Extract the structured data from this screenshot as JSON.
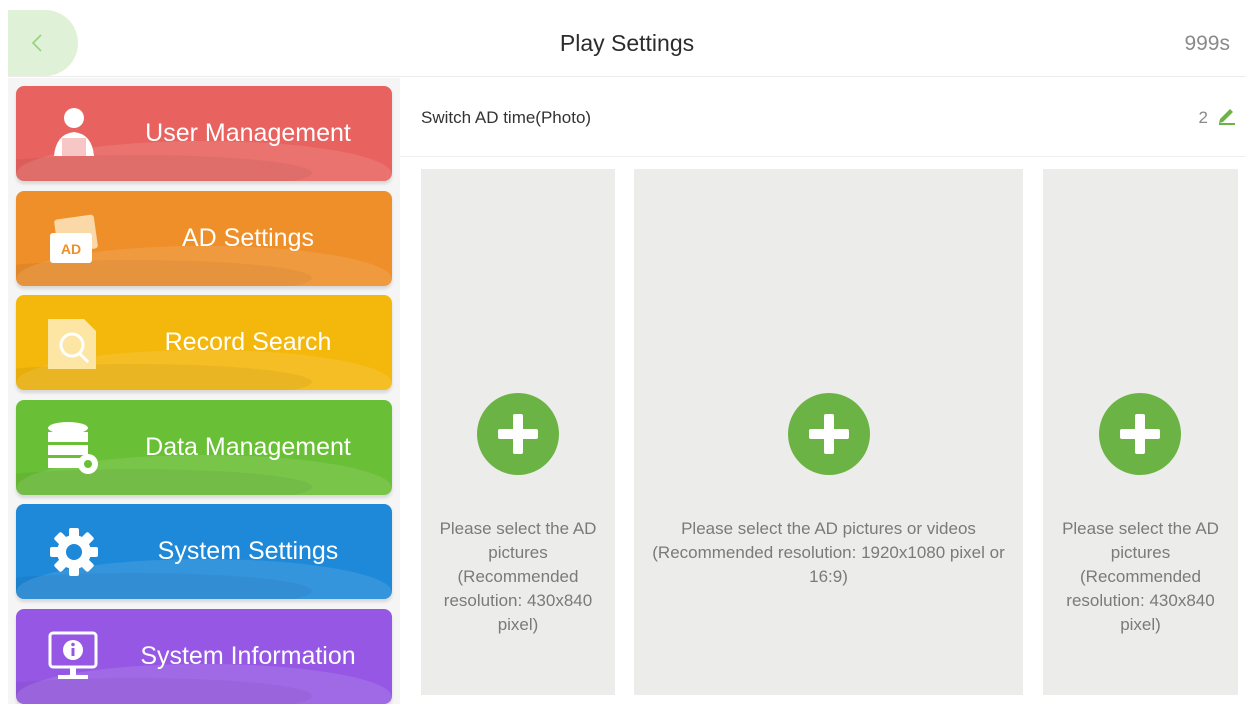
{
  "header": {
    "title": "Play Settings",
    "timer": "999s",
    "back_icon": "chevron-left-icon"
  },
  "sidebar": {
    "items": [
      {
        "label": "User Management",
        "icon": "user-icon",
        "color": "#e8625f"
      },
      {
        "label": "AD Settings",
        "icon": "ad-icon",
        "color": "#ef8f2a"
      },
      {
        "label": "Record Search",
        "icon": "search-document-icon",
        "color": "#f4b70c"
      },
      {
        "label": "Data Management",
        "icon": "database-gear-icon",
        "color": "#69bf36"
      },
      {
        "label": "System Settings",
        "icon": "gear-icon",
        "color": "#1e88d9"
      },
      {
        "label": "System Information",
        "icon": "info-monitor-icon",
        "color": "#9658e4"
      }
    ]
  },
  "ad_time": {
    "label": "Switch AD time(Photo)",
    "value": "2",
    "edit_icon": "pencil-icon"
  },
  "panels": [
    {
      "text": "Please select the AD pictures (Recommended resolution: 430x840 pixel)",
      "icon": "plus-icon"
    },
    {
      "text": "Please select the AD pictures or videos (Recommended resolution: 1920x1080 pixel or 16:9)",
      "icon": "plus-icon"
    },
    {
      "text": "Please select the AD pictures (Recommended resolution: 430x840 pixel)",
      "icon": "plus-icon"
    }
  ],
  "colors": {
    "accent_green": "#6cb345",
    "panel_bg": "#ecedea"
  }
}
